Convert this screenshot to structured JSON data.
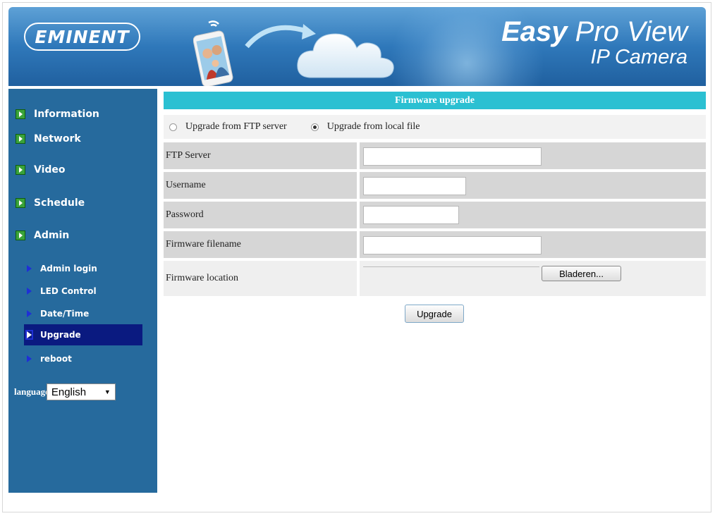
{
  "header": {
    "logo_text": "EMINENT",
    "brand_line1_bold": "Easy",
    "brand_line1_rest": " Pro View",
    "brand_line2": "IP Camera"
  },
  "sidebar": {
    "items": [
      {
        "label": "Information"
      },
      {
        "label": "Network"
      },
      {
        "label": "Video"
      },
      {
        "label": "Schedule"
      },
      {
        "label": "Admin"
      }
    ],
    "admin_subitems": [
      {
        "label": "Admin login"
      },
      {
        "label": "LED Control"
      },
      {
        "label": "Date/Time"
      },
      {
        "label": "Upgrade",
        "active": true
      },
      {
        "label": "reboot"
      }
    ],
    "language_label": "language",
    "language_selected": "English"
  },
  "main": {
    "title": "Firmware upgrade",
    "radio_ftp": "Upgrade from FTP server",
    "radio_local": "Upgrade from local file",
    "selected_source": "local",
    "fields": {
      "ftp_server": {
        "label": "FTP Server",
        "value": ""
      },
      "username": {
        "label": "Username",
        "value": ""
      },
      "password": {
        "label": "Password",
        "value": ""
      },
      "firmware_filename": {
        "label": "Firmware filename",
        "value": ""
      },
      "firmware_location": {
        "label": "Firmware location"
      }
    },
    "browse_label": "Bladeren...",
    "upgrade_label": "Upgrade"
  },
  "colors": {
    "sidebar_bg": "#266a9d",
    "title_bar": "#2bc0d2",
    "active_item": "#0a1a80",
    "green_bullet": "#3aa33a"
  }
}
